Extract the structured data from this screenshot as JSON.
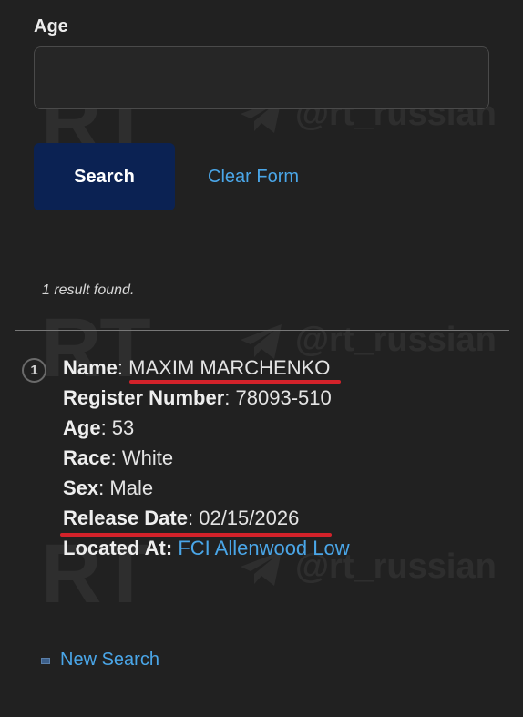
{
  "form": {
    "age_label": "Age",
    "age_value": "",
    "age_placeholder": "",
    "search_label": "Search",
    "clear_label": "Clear Form"
  },
  "results": {
    "count_text": "1 result found.",
    "items": [
      {
        "index": "1",
        "name_key": "Name",
        "name_value": "MAXIM MARCHENKO",
        "register_key": "Register Number",
        "register_value": "78093-510",
        "age_key": "Age",
        "age_value": "53",
        "race_key": "Race",
        "race_value": "White",
        "sex_key": "Sex",
        "sex_value": "Male",
        "release_key": "Release Date",
        "release_value": "02/15/2026",
        "location_key": "Located At:",
        "location_value": "FCI Allenwood Low"
      }
    ]
  },
  "new_search_label": "New Search",
  "watermark": {
    "logo_text": "RT",
    "handle": "@rt_russian"
  },
  "colors": {
    "background": "#212121",
    "link": "#4aa6e8",
    "button": "#0b2253",
    "highlight_underline": "#d3222a"
  },
  "icons": {
    "watermark": "telegram-plane-icon",
    "new_search": "new-search-icon",
    "result_marker": "numbered-circle"
  }
}
